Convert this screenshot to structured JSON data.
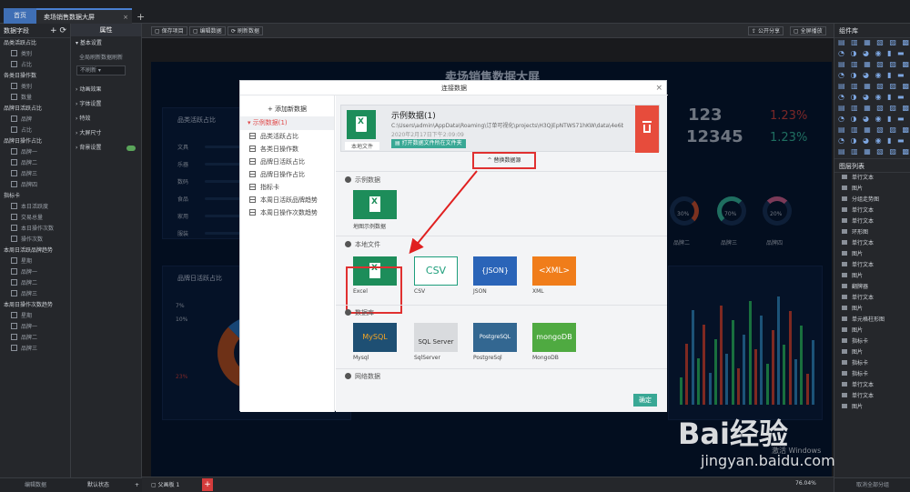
{
  "tabs": {
    "home": "首页",
    "current": "卖场销售数据大屏"
  },
  "left_panel": {
    "title": "数据字段",
    "groups": [
      {
        "name": "品类活跃占比",
        "fields": [
          "类别",
          "占比"
        ]
      },
      {
        "name": "各类日操作数",
        "fields": [
          "类别",
          "数量"
        ]
      },
      {
        "name": "品牌日活跃占比",
        "fields": [
          "品牌",
          "占比"
        ]
      },
      {
        "name": "品牌日操作占比",
        "fields": [
          "品牌一",
          "品牌二",
          "品牌三",
          "品牌四"
        ]
      },
      {
        "name": "指标卡",
        "fields": [
          "本日活跃度",
          "交易总量",
          "本日操作次数",
          "操作次数"
        ]
      },
      {
        "name": "本周日活跃品牌趋势",
        "fields": [
          "星期",
          "品牌一",
          "品牌二",
          "品牌三"
        ]
      },
      {
        "name": "本周日操作次数趋势",
        "fields": [
          "星期",
          "品牌一",
          "品牌二",
          "品牌三"
        ]
      }
    ],
    "bottom": "编辑数据"
  },
  "prop_panel": {
    "tab": "属性",
    "basic": "基本设置",
    "refresh_label": "全局刷新数据刷新",
    "refresh_value": "不刷新",
    "items": [
      "动画效果",
      "字体设置",
      "特效",
      "大屏尺寸",
      "背景设置"
    ],
    "bottom": "默认状态"
  },
  "toolbar": {
    "save": "保存项目",
    "edit": "编辑数据",
    "refresh": "刷新数据",
    "share": "公开分享",
    "fullscreen": "全屏播放"
  },
  "screen": {
    "title": "卖场销售数据大屏",
    "card1_title": "品类活跃占比",
    "card1_labels": [
      "文具",
      "乐器",
      "数码",
      "食品",
      "家用",
      "服装"
    ],
    "card2_title": "品牌日活跃占比",
    "card2_pcts": [
      "7%",
      "10%",
      "23%"
    ],
    "num1": "123",
    "num2": "12345",
    "pct1": "1.23%",
    "pct2": "1.23%",
    "rings": [
      "30%",
      "70%",
      "20%"
    ],
    "ring_labels": [
      "品牌二",
      "品牌三",
      "品牌四"
    ]
  },
  "modal": {
    "title": "连接数据",
    "add": "添加新数据",
    "source": "示例数据(1)",
    "tables": [
      "品类活跃占比",
      "各类日操作数",
      "品牌日活跃占比",
      "品牌日操作占比",
      "指标卡",
      "本周日活跃品牌趋势",
      "本周日操作次数趋势"
    ],
    "src_title": "示例数据(1)",
    "src_path": "C:\\Users\\admin\\AppData\\Roaming\\订单可视化\\projects\\H3QjEpNTWS71hKW\\data\\4e6b88...",
    "src_time": "2020年2月17日下午2:09:09",
    "src_open": "打开数据文件所在文件夹",
    "src_caption": "本地文件",
    "switch": "替换数据源",
    "sec_example": "示例数据",
    "example_tile": "地图示例数据",
    "sec_local": "本地文件",
    "local_tiles": [
      "Excel",
      "CSV",
      "JSON",
      "XML"
    ],
    "sec_db": "数据库",
    "db_tiles": [
      "Mysql",
      "SqlServer",
      "PostgreSql",
      "MongoDB"
    ],
    "sec_net": "网络数据",
    "ok": "确定"
  },
  "right_panel": {
    "title": "组件库",
    "layers_title": "图层列表",
    "layers": [
      "单行文本",
      "图片",
      "分组走势图",
      "单行文本",
      "单行文本",
      "环形图",
      "单行文本",
      "图片",
      "单行文本",
      "图片",
      "翻牌器",
      "单行文本",
      "图片",
      "单元格柱形图",
      "图片",
      "指标卡",
      "图片",
      "指标卡",
      "指标卡",
      "单行文本",
      "单行文本",
      "图片"
    ],
    "bottom": "取消全部分组"
  },
  "status": {
    "scene": "父画板 1",
    "zoom": "76.04%"
  },
  "watermark": {
    "brand": "Bai经验",
    "url": "jingyan.baidu.com",
    "win": "激活 Windows"
  }
}
